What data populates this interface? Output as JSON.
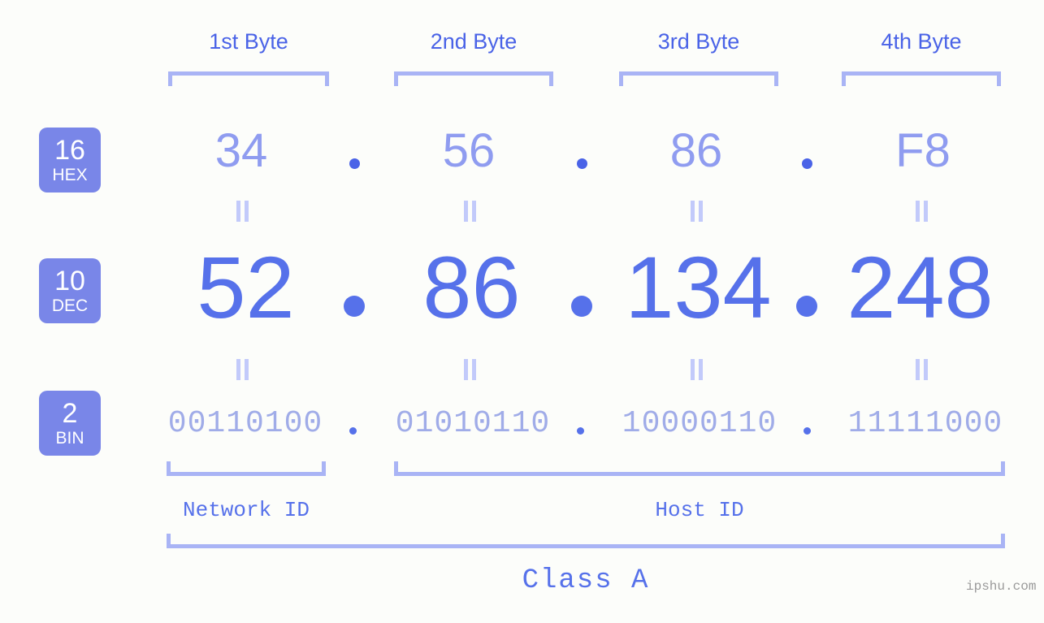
{
  "background_color": "#fcfdfa",
  "colors": {
    "light_blue": "#a9b4f5",
    "mid_blue": "#8f9cf0",
    "dark_blue": "#4a63e7",
    "value_blue": "#5671ea",
    "badge_bg": "#7986e8",
    "badge_text": "#ffffff",
    "watermark": "#9a9a9a"
  },
  "byte_headers": [
    {
      "label": "1st Byte"
    },
    {
      "label": "2nd Byte"
    },
    {
      "label": "3rd Byte"
    },
    {
      "label": "4th Byte"
    }
  ],
  "rows": {
    "hex": {
      "badge_num": "16",
      "badge_name": "HEX",
      "values": [
        "34",
        "56",
        "86",
        "F8"
      ],
      "separator": "."
    },
    "dec": {
      "badge_num": "10",
      "badge_name": "DEC",
      "values": [
        "52",
        "86",
        "134",
        "248"
      ],
      "separator": "."
    },
    "bin": {
      "badge_num": "2",
      "badge_name": "BIN",
      "values": [
        "00110100",
        "01010110",
        "10000110",
        "11111000"
      ],
      "separator": "."
    }
  },
  "equality_mark": "=",
  "sections": {
    "network_id": "Network ID",
    "host_id": "Host ID",
    "class": "Class A"
  },
  "watermark": "ipshu.com"
}
